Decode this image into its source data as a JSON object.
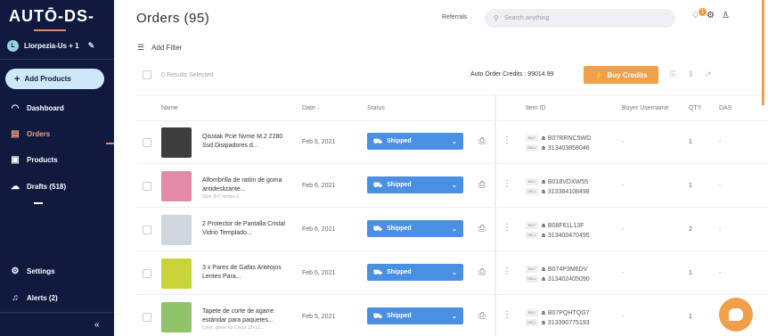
{
  "sidebar": {
    "logo": "AUTŌ-DS-",
    "store": {
      "avatar": "L",
      "name": "Llorpezia-Us + 1"
    },
    "add_products": "Add Products",
    "items": [
      {
        "label": "Dashboard",
        "icon": "speedometer-icon"
      },
      {
        "label": "Orders",
        "icon": "orders-icon",
        "active": true
      },
      {
        "label": "Products",
        "icon": "box-icon"
      },
      {
        "label": "Drafts (518)",
        "icon": "drafts-icon"
      }
    ],
    "bottom_items": [
      {
        "label": "Settings",
        "icon": "gear-icon"
      },
      {
        "label": "Alerts (2)",
        "icon": "bell-icon"
      }
    ],
    "collapse": "«"
  },
  "header": {
    "title": "Orders (95)",
    "referrals": "Referrals",
    "search_placeholder": "Search anything",
    "notification_count": "1"
  },
  "toolbar": {
    "add_filter": "Add Filter",
    "results": "0 Results Selected",
    "credits": "Auto Order Credits : 99014.99",
    "buy_credits": "Buy Credits"
  },
  "columns": {
    "name": "Name",
    "date": "Date",
    "status": "Status",
    "item_id": "Item ID",
    "buyer": "Buyer Username",
    "qty": "QTY",
    "das": "DAS"
  },
  "rows": [
    {
      "name": "Qisstak Pcie Nvme M.2 2280 Ssd Disipadores d...",
      "sub": "",
      "date": "Feb 6, 2021",
      "status": "Shipped",
      "buy_id": "B07RRNC5WD",
      "sell_id": "313403858046",
      "buyer": "-",
      "qty": "1",
      "das": "-",
      "thumb": "#3d3d3d"
    },
    {
      "name": "Alfombrilla de ratón de goma antideslizante...",
      "sub": "Size: 9×7 inches-3",
      "date": "Feb 6, 2021",
      "status": "Shipped",
      "buy_id": "B018VDXW55",
      "sell_id": "313384108498",
      "buyer": "-",
      "qty": "1",
      "das": "-",
      "thumb": "#e38aa8"
    },
    {
      "name": "2 Protector de Pantalla Cristal Vidrio Templado...",
      "sub": "",
      "date": "Feb 6, 2021",
      "status": "Shipped",
      "buy_id": "B08F61L13F",
      "sell_id": "313400470495",
      "buyer": "-",
      "qty": "2",
      "das": "-",
      "thumb": "#cfd6de"
    },
    {
      "name": "3 x Pares de Gafas Anteojos Lentes Para...",
      "sub": "",
      "date": "Feb 5, 2021",
      "status": "Shipped",
      "buy_id": "B074P3M6DV",
      "sell_id": "313402405090",
      "buyer": "-",
      "qty": "1",
      "das": "-",
      "thumb": "#c9d33a"
    },
    {
      "name": "Tapete de corte de agarre estándar para paquetes...",
      "sub": "Color: green for Cricut 12×12...",
      "date": "Feb 5, 2021",
      "status": "Shipped",
      "buy_id": "B07PQHTQG7",
      "sell_id": "313390775193",
      "buyer": "-",
      "qty": "1",
      "das": "-",
      "thumb": "#8fc46b"
    }
  ],
  "labels": {
    "buy": "BUY",
    "sell": "SELL",
    "amazon": "a",
    "sort": "↓"
  }
}
